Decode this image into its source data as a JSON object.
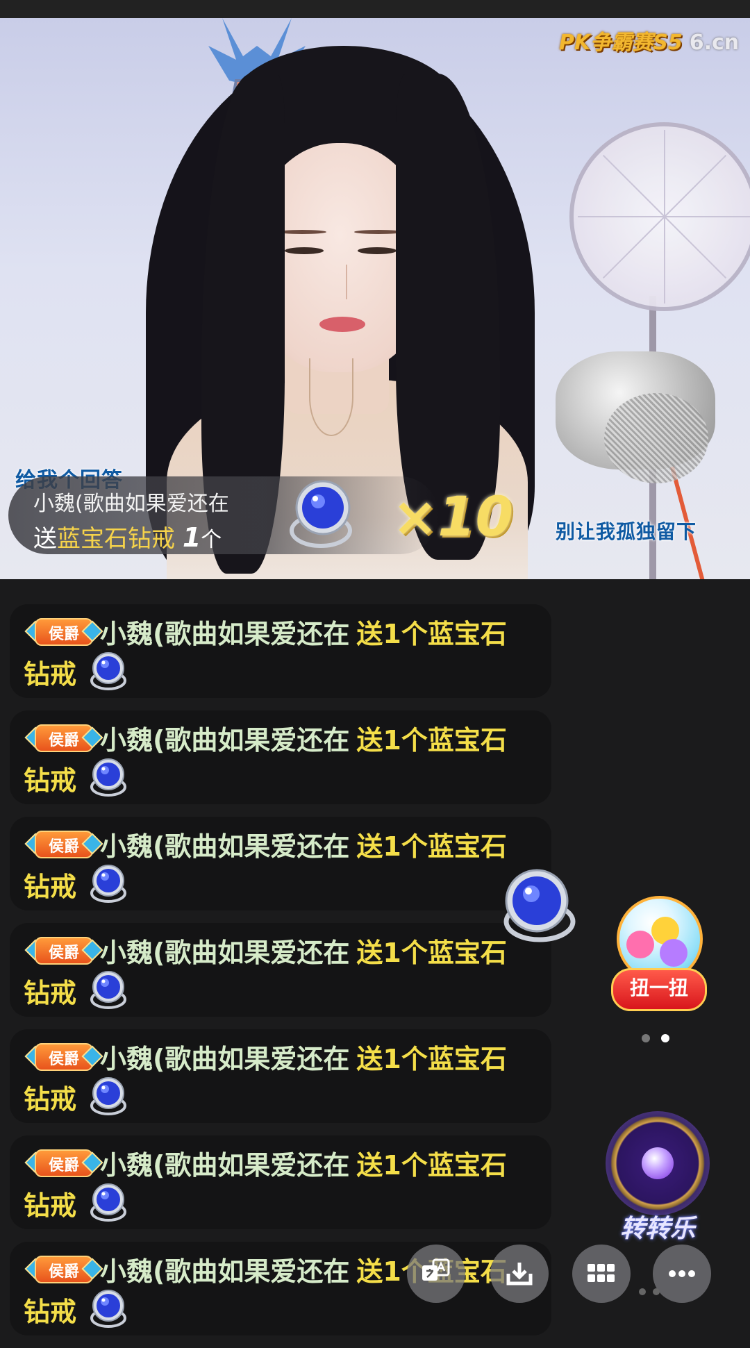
{
  "stream": {
    "logo_text": "PK争霸赛S5",
    "logo_domain": "6.cn",
    "lyric_top": "给我个回答",
    "lyric_right": "别让我孤独留下"
  },
  "gift_banner": {
    "sender": "小魏(歌曲如果爱还在",
    "send_word": "送",
    "gift_name": "蓝宝石钻戒",
    "count": "1",
    "unit": "个",
    "combo": "×10"
  },
  "chat": {
    "messages": [
      {
        "badge": "侯爵",
        "user": "小魏(歌曲如果爱还在",
        "gift_text": "送1个蓝宝石",
        "gift_tail": "钻戒"
      },
      {
        "badge": "侯爵",
        "user": "小魏(歌曲如果爱还在",
        "gift_text": "送1个蓝宝石",
        "gift_tail": "钻戒"
      },
      {
        "badge": "侯爵",
        "user": "小魏(歌曲如果爱还在",
        "gift_text": "送1个蓝宝石",
        "gift_tail": "钻戒"
      },
      {
        "badge": "侯爵",
        "user": "小魏(歌曲如果爱还在",
        "gift_text": "送1个蓝宝石",
        "gift_tail": "钻戒"
      },
      {
        "badge": "侯爵",
        "user": "小魏(歌曲如果爱还在",
        "gift_text": "送1个蓝宝石",
        "gift_tail": "钻戒"
      },
      {
        "badge": "侯爵",
        "user": "小魏(歌曲如果爱还在",
        "gift_text": "送1个蓝宝石",
        "gift_tail": "钻戒"
      },
      {
        "badge": "侯爵",
        "user": "小魏(歌曲如果爱还在",
        "gift_text": "送1个蓝宝石",
        "gift_tail": "钻戒"
      }
    ]
  },
  "widgets": {
    "capsule_label": "扭一扭",
    "spin_label": "转转乐"
  },
  "icons": {
    "translate": "translate-icon",
    "download": "download-icon",
    "grid": "grid-icon",
    "more": "more-icon"
  },
  "colors": {
    "background": "#1b1b1c",
    "gift_yellow": "#f4de49",
    "username_green": "#d6ebc9",
    "lyric_blue": "#0f5aa3"
  }
}
